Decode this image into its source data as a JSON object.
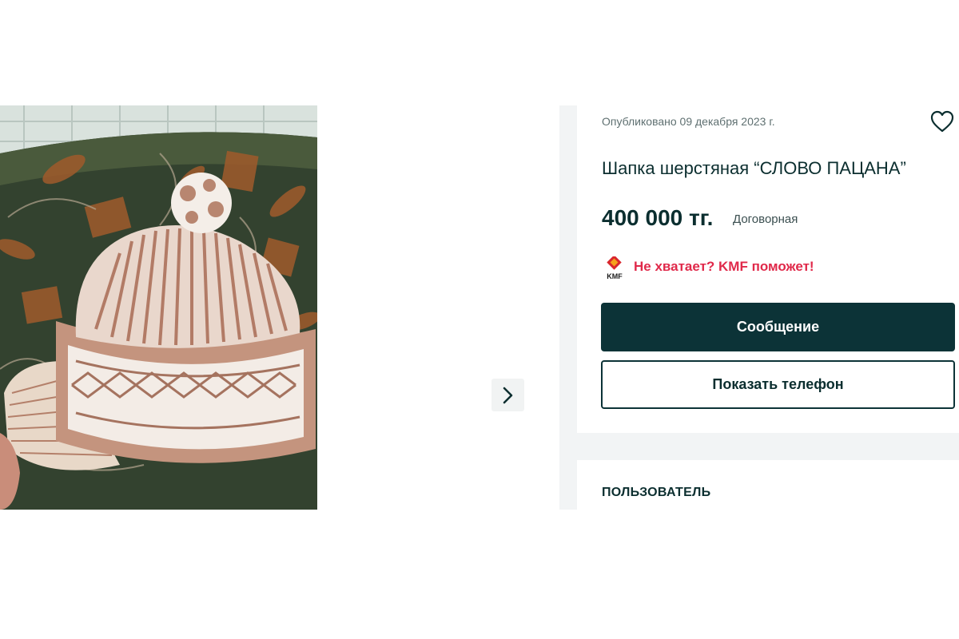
{
  "listing": {
    "published": "Опубликовано 09 декабря 2023 г.",
    "title": "Шапка шерстяная “СЛОВО ПАЦАНА”",
    "price": "400 000 тг.",
    "price_note": "Договорная",
    "kmf_promo": "Не хватает? KMF поможет!",
    "kmf_logo_text": "KMF"
  },
  "actions": {
    "message_label": "Сообщение",
    "show_phone_label": "Показать телефон"
  },
  "user_section": {
    "heading": "ПОЛЬЗОВАТЕЛЬ"
  },
  "icons": {
    "favorite": "heart-icon",
    "next": "chevron-right-icon"
  },
  "colors": {
    "primary": "#0c3337",
    "promo": "#e0294a",
    "kmf_red": "#d9262c",
    "kmf_orange": "#f5a11c"
  }
}
